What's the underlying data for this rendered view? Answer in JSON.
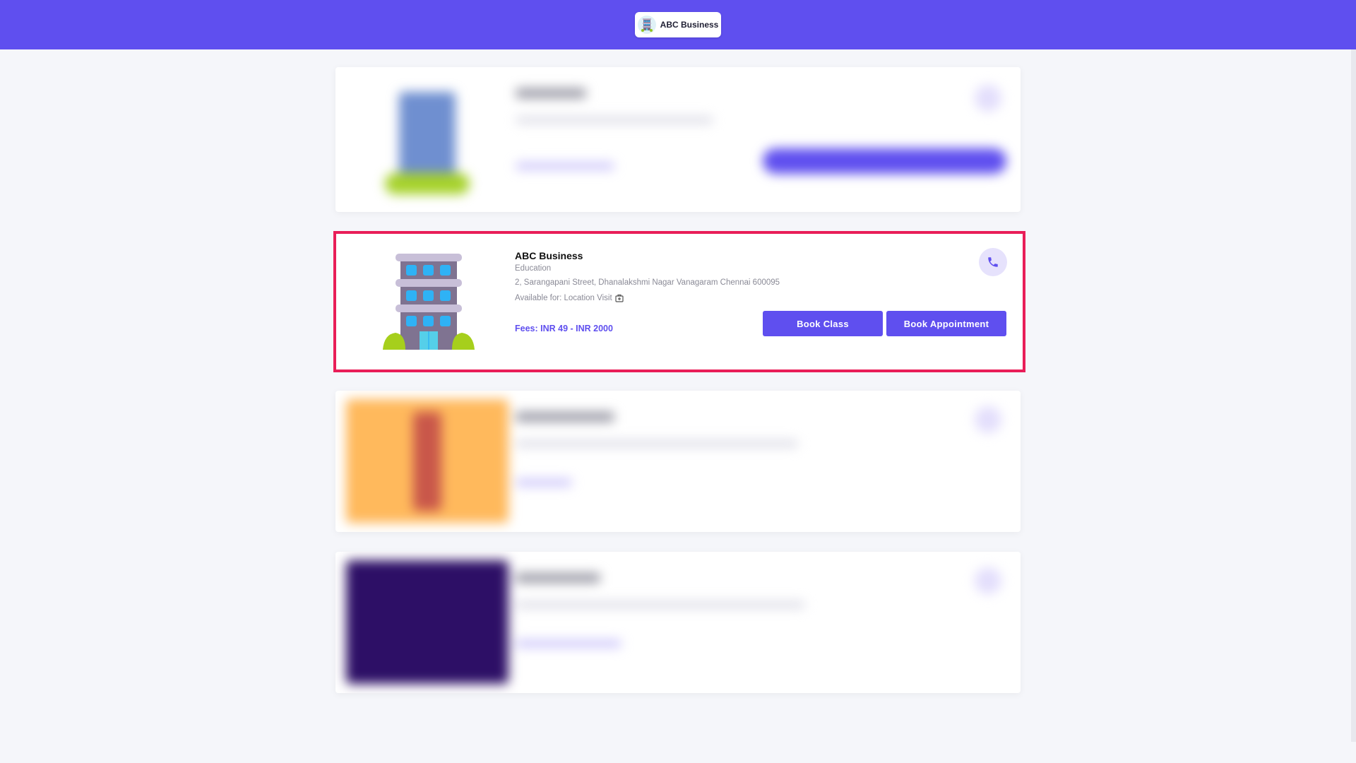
{
  "header": {
    "brand_name": "ABC Business",
    "brand_icon": "building-icon",
    "color": "#5f4fef"
  },
  "listing": {
    "name": "ABC Business",
    "category": "Education",
    "address": "2, Sarangapani Street, Dhanalakshmi Nagar Vanagaram Chennai 600095",
    "availability": "Available for: Location Visit",
    "fees": "Fees: INR 49 - INR 2000",
    "buttons": {
      "book_class": "Book Class",
      "book_appointment": "Book Appointment"
    },
    "icons": {
      "illustration": "building-icon",
      "call": "phone-icon",
      "visit": "location-visit-icon"
    },
    "highlight_color": "#e91e58"
  }
}
